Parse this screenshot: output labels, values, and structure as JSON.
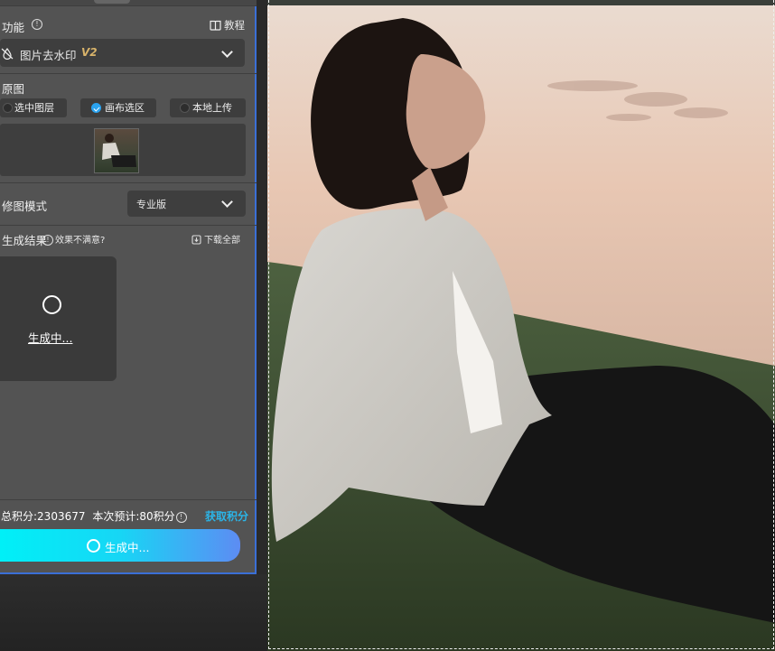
{
  "panel": {
    "function_label": "功能",
    "tutorial_label": "教程",
    "function_select": {
      "name": "图片去水印",
      "version": "V2"
    },
    "source_label": "原图",
    "source_options": [
      {
        "label": "选中图层",
        "checked": false
      },
      {
        "label": "画布选区",
        "checked": true
      },
      {
        "label": "本地上传",
        "checked": false
      }
    ],
    "mode_label": "修图模式",
    "mode_value": "专业版",
    "result_label": "生成结果",
    "unsatisfied_label": "效果不满意?",
    "download_all_label": "下载全部",
    "generating_text": "生成中...",
    "total_points_text": "总积分:2303677",
    "estimate_text": "本次预计:80积分",
    "get_points_label": "获取积分",
    "generate_button_label": "生成中..."
  },
  "colors": {
    "accent_blue": "#3b6fd6",
    "link_cyan": "#2bb5e8",
    "button_gradient_start": "#00f0f7",
    "button_gradient_end": "#5d8cf3",
    "version_gold": "#d8b36a"
  }
}
